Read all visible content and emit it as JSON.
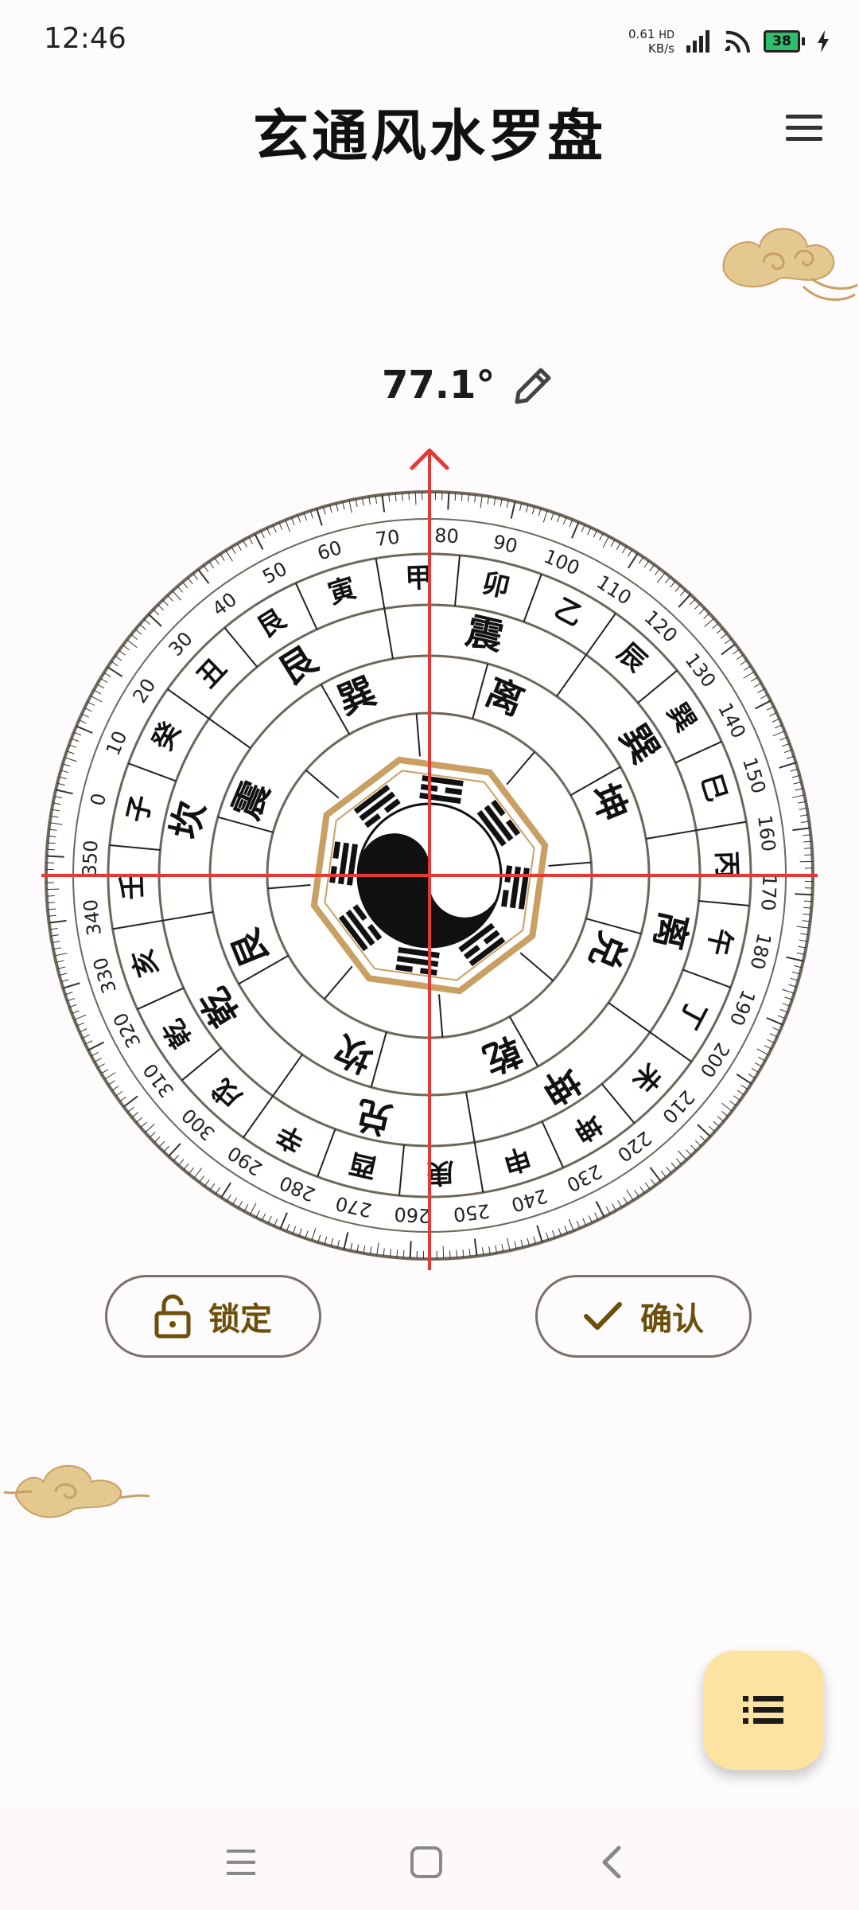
{
  "status_bar": {
    "time": "12:46",
    "net_speed_value": "0.61",
    "net_speed_unit": "KB/s",
    "hd_label": "HD",
    "battery_level": "38"
  },
  "header": {
    "title": "玄通风水罗盘"
  },
  "compass": {
    "heading_text": "77.1°",
    "heading_degrees": 77.1,
    "rings": {
      "mountains": [
        "子",
        "癸",
        "丑",
        "艮",
        "寅",
        "甲",
        "卯",
        "乙",
        "辰",
        "巽",
        "巳",
        "丙",
        "午",
        "丁",
        "未",
        "坤",
        "申",
        "庚",
        "酉",
        "辛",
        "戌",
        "乾",
        "亥",
        "壬"
      ],
      "middle": [
        "震",
        "巽",
        "离",
        "坤",
        "兑",
        "乾",
        "坎",
        "艮"
      ],
      "outer_eight": [
        "坎",
        "艮",
        "震",
        "巽",
        "离",
        "坤",
        "兑",
        "乾"
      ],
      "inner": [
        "辰",
        "申",
        "午",
        "寅",
        "戌",
        "卯",
        "巳",
        "亥",
        "酉",
        "丑",
        "子"
      ]
    },
    "degree_labels": [
      "0",
      "10",
      "20",
      "30",
      "40",
      "50",
      "60",
      "70",
      "80",
      "90",
      "100",
      "110",
      "120",
      "130",
      "140",
      "150",
      "160",
      "170",
      "180",
      "190",
      "200",
      "210",
      "220",
      "230",
      "240",
      "250",
      "260",
      "270",
      "280",
      "290",
      "300",
      "310",
      "320",
      "330",
      "340",
      "350"
    ]
  },
  "actions": {
    "lock_label": "锁定",
    "confirm_label": "确认"
  },
  "colors": {
    "accent_red": "#e53935",
    "gold": "#c9a063",
    "button_text": "#6b4f0a",
    "fab_bg": "#fde3a2"
  }
}
